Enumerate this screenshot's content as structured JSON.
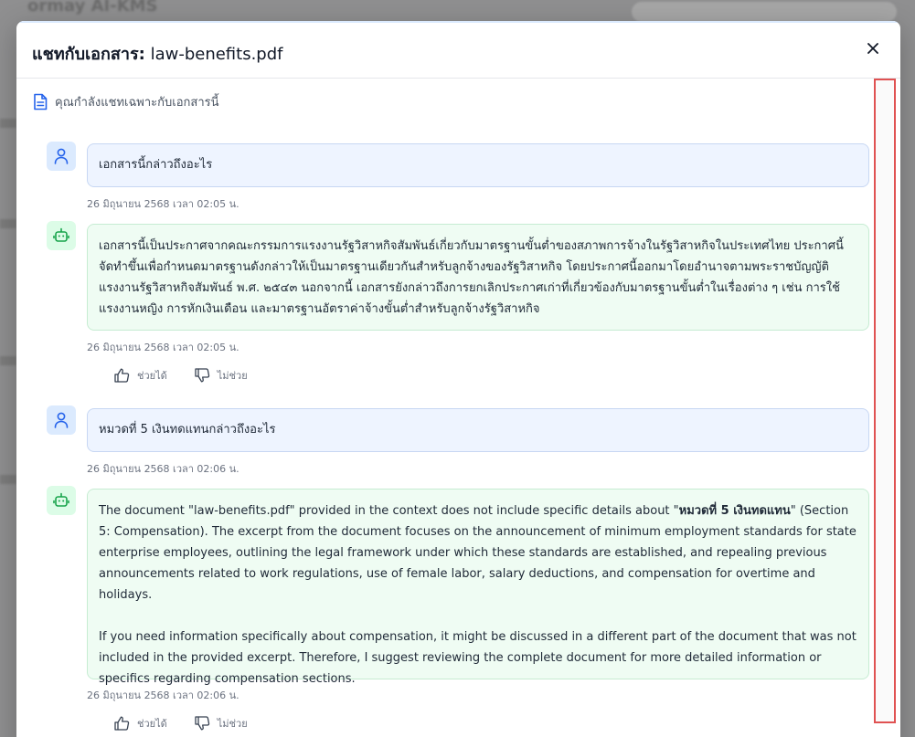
{
  "background": {
    "title": "ormay AI-KMS"
  },
  "modal": {
    "title_prefix": "แชทกับเอกสาร:",
    "title_file": "law-benefits.pdf",
    "notice": "คุณกำลังแชทเฉพาะกับเอกสารนี้"
  },
  "messages": [
    {
      "role": "user",
      "text": "เอกสารนี้กล่าวถึงอะไร",
      "time": "26 มิถุนายน 2568 เวลา 02:05 น."
    },
    {
      "role": "bot",
      "text": "เอกสารนี้เป็นประกาศจากคณะกรรมการแรงงานรัฐวิสาหกิจสัมพันธ์เกี่ยวกับมาตรฐานขั้นต่ำของสภาพการจ้างในรัฐวิสาหกิจในประเทศไทย ประกาศนี้จัดทำขึ้นเพื่อกำหนดมาตรฐานดังกล่าวให้เป็นมาตรฐานเดียวกันสำหรับลูกจ้างของรัฐวิสาหกิจ โดยประกาศนี้ออกมาโดยอำนาจตามพระราชบัญญัติแรงงานรัฐวิสาหกิจสัมพันธ์ พ.ศ. ๒๕๔๓ นอกจากนี้ เอกสารยังกล่าวถึงการยกเลิกประกาศเก่าที่เกี่ยวข้องกับมาตรฐานขั้นต่ำในเรื่องต่าง ๆ เช่น การใช้แรงงานหญิง การหักเงินเดือน และมาตรฐานอัตราค่าจ้างขั้นต่ำสำหรับลูกจ้างรัฐวิสาหกิจ",
      "time": "26 มิถุนายน 2568 เวลา 02:05 น.",
      "helpful": "ช่วยได้",
      "not_helpful": "ไม่ช่วย"
    },
    {
      "role": "user",
      "text": "หมวดที่ 5 เงินทดแทนกล่าวถึงอะไร",
      "time": "26 มิถุนายน 2568 เวลา 02:06 น."
    },
    {
      "role": "bot",
      "text_pre": "The document \"law-benefits.pdf\" provided in the context does not include specific details about \"",
      "text_bold": "หมวดที่ 5 เงินทดแทน",
      "text_post": "\" (Section 5: Compensation). The excerpt from the document focuses on the announcement of minimum employment standards for state enterprise employees, outlining the legal framework under which these standards are established, and repealing previous announcements related to work regulations, use of female labor, salary deductions, and compensation for overtime and holidays.",
      "text_para2": "If you need information specifically about compensation, it might be discussed in a different part of the document that was not included in the provided excerpt. Therefore, I suggest reviewing the complete document for more detailed information or specifics regarding compensation sections.",
      "time": "26 มิถุนายน 2568 เวลา 02:06 น.",
      "helpful": "ช่วยได้",
      "not_helpful": "ไม่ช่วย"
    }
  ],
  "colors": {
    "user_bubble": "#eef4ff",
    "bot_bubble": "#effcf3",
    "highlight": "#e05252"
  }
}
